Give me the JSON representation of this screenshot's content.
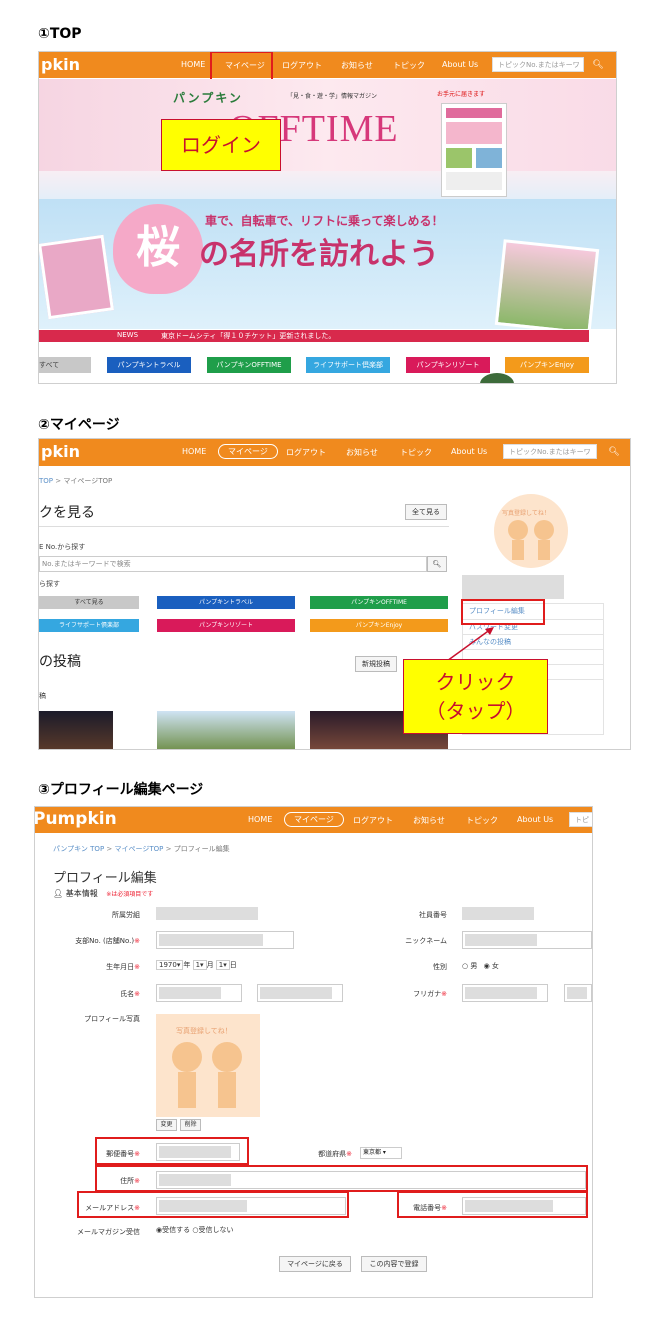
{
  "sections": {
    "s1": "①TOP",
    "s2": "②マイページ",
    "s3": "③プロフィール編集ページ"
  },
  "nav": {
    "logo": "pkin",
    "logo_full": "Pumpkin",
    "home": "HOME",
    "mypage": "マイページ",
    "logout": "ログアウト",
    "news": "お知らせ",
    "topic": "トピック",
    "about": "About Us",
    "search_placeholder": "トピックNo.またはキーワ",
    "search_short": "トピ"
  },
  "top": {
    "banner_brand_kana": "パンプキン",
    "banner_tagline": "「見・食・遊・学」情報マガジン",
    "banner_offtime": "OFFTIME",
    "banner_hand": "お手元に届きます",
    "banner_headline": "車で、自転車で、リフトに乗って楽しめる！",
    "banner_sakura": "桜",
    "banner_main": "の名所を訪れよう",
    "news_label": "NEWS",
    "news_text": "東京ドームシティ「得１０チケット」更新されました。",
    "callout": "ログイン",
    "cats": [
      "すべて",
      "パンプキントラベル",
      "パンプキンOFFTIME",
      "ライフサポート倶楽部",
      "パンプキンリゾート",
      "パンプキンEnjoy"
    ]
  },
  "mypage": {
    "crumb_top": "TOP",
    "crumb_sep": ">",
    "crumb_current": "マイページTOP",
    "heading": "クを見る",
    "viewall": "全て見る",
    "searchby": "E No.から探す",
    "search_ph": "No.またはキーワードで検索",
    "search_icon_label": "🔍",
    "cat_label": "ら探す",
    "cats": [
      "すべて見る",
      "パンプキントラベル",
      "パンプキンOFFTIME",
      "ライフサポート倶楽部",
      "パンプキンリゾート",
      "パンプキンEnjoy"
    ],
    "posts_heading": "の投稿",
    "newpost": "新規投稿",
    "posts_sub": "稿",
    "avatar_text": "写真登録してね！",
    "sidebar": [
      "プロフィール編集",
      "パスワード変更",
      "みんなの投稿"
    ],
    "callout_line1": "クリック",
    "callout_line2": "（タップ）"
  },
  "profile": {
    "crumb": [
      "パンプキン TOP",
      "マイページTOP",
      "プロフィール編集"
    ],
    "crumb_sep": ">",
    "title": "プロフィール編集",
    "basic": "基本情報",
    "required_note": "※は必須項目です",
    "labels": {
      "dept": "所属労組",
      "empno": "社員番号",
      "branch": "支部No. (店舗No.)",
      "nick": "ニックネーム",
      "birth": "生年月日",
      "gender": "性別",
      "name": "氏名",
      "kana": "フリガナ",
      "photo": "プロフィール写真",
      "zip": "郵便番号",
      "pref": "都道府県",
      "addr": "住所",
      "mail": "メールアドレス",
      "tel": "電話番号",
      "magazine": "メールマガジン受信"
    },
    "req_mark": "※",
    "birth_year": "1970",
    "year_unit": "年",
    "birth_month": "1",
    "month_unit": "月",
    "birth_day": "1",
    "day_unit": "日",
    "gender_m": "男",
    "gender_f": "女",
    "pref_value": "東京都",
    "mag_yes": "受信する",
    "mag_no": "受信しない",
    "photo_change": "変更",
    "photo_delete": "削除",
    "back": "マイページに戻る",
    "submit": "この内容で登録",
    "avatar_text": "写真登録してね！"
  },
  "colors": {
    "orange": "#f08a1e",
    "blue": "#1a5fbf",
    "green": "#1f9e4a",
    "lightblue": "#35a7e0",
    "crimson": "#d91a5a",
    "amber": "#f39a1b",
    "gray": "#c8c8c8",
    "red": "#e01c1c"
  }
}
